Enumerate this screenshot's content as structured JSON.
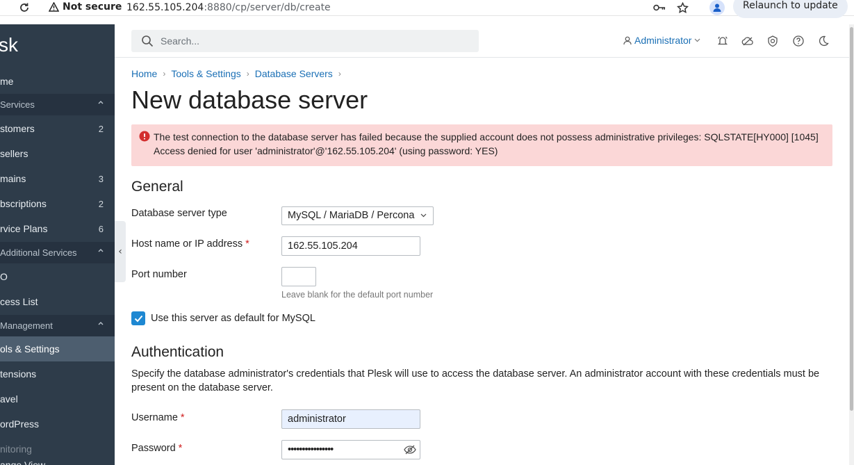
{
  "browser": {
    "not_secure": "Not secure",
    "url_host": "162.55.105.204",
    "url_path": ":8880/cp/server/db/create",
    "relaunch": "Relaunch to update"
  },
  "sidebar": {
    "logo": "sk",
    "collapse_glyph": "‹",
    "items": [
      {
        "label": "me",
        "count": ""
      },
      {
        "label": " Services",
        "group": true
      },
      {
        "label": "stomers",
        "count": "2"
      },
      {
        "label": "sellers",
        "count": ""
      },
      {
        "label": "mains",
        "count": "3"
      },
      {
        "label": "bscriptions",
        "count": "2"
      },
      {
        "label": "rvice Plans",
        "count": "6"
      },
      {
        "label": " Additional Services",
        "group": true
      },
      {
        "label": "O",
        "count": ""
      },
      {
        "label": "cess List",
        "count": ""
      },
      {
        "label": "Management",
        "group": true
      },
      {
        "label": "ols & Settings",
        "count": "",
        "active": true
      },
      {
        "label": "tensions",
        "count": ""
      },
      {
        "label": "avel",
        "count": ""
      },
      {
        "label": "ordPress",
        "count": ""
      },
      {
        "label": "nitoring",
        "count": ""
      },
      {
        "label": "ange View",
        "count": ""
      }
    ]
  },
  "header": {
    "search_placeholder": "Search...",
    "user": "Administrator",
    "icons": [
      "notifications-icon",
      "cloud-icon",
      "shield-icon",
      "help-icon",
      "dark-mode-icon"
    ]
  },
  "breadcrumb": [
    "Home",
    "Tools & Settings",
    "Database Servers"
  ],
  "page_title": "New database server",
  "alert": {
    "text": "The test connection to the database server has failed because the supplied account does not possess administrative privileges: SQLSTATE[HY000] [1045] Access denied for user 'administrator'@'162.55.105.204' (using password: YES)"
  },
  "general": {
    "title": "General",
    "server_type_label": "Database server type",
    "server_type_value": "MySQL / MariaDB / Percona",
    "host_label": "Host name or IP address",
    "host_value": "162.55.105.204",
    "port_label": "Port number",
    "port_value": "",
    "port_hint": "Leave blank for the default port number",
    "default_label": "Use this server as default for MySQL",
    "required_mark": "*"
  },
  "auth": {
    "title": "Authentication",
    "description": "Specify the database administrator's credentials that Plesk will use to access the database server. An administrator account with these credentials must be present on the database server.",
    "username_label": "Username",
    "username_value": "administrator",
    "password_label": "Password",
    "password_value": "••••••••••••••••"
  },
  "colors": {
    "sidebar_bg": "#2e3c4a",
    "link": "#1a6fb5",
    "alert_bg": "#fbd7d7",
    "accent": "#1e88d2"
  }
}
